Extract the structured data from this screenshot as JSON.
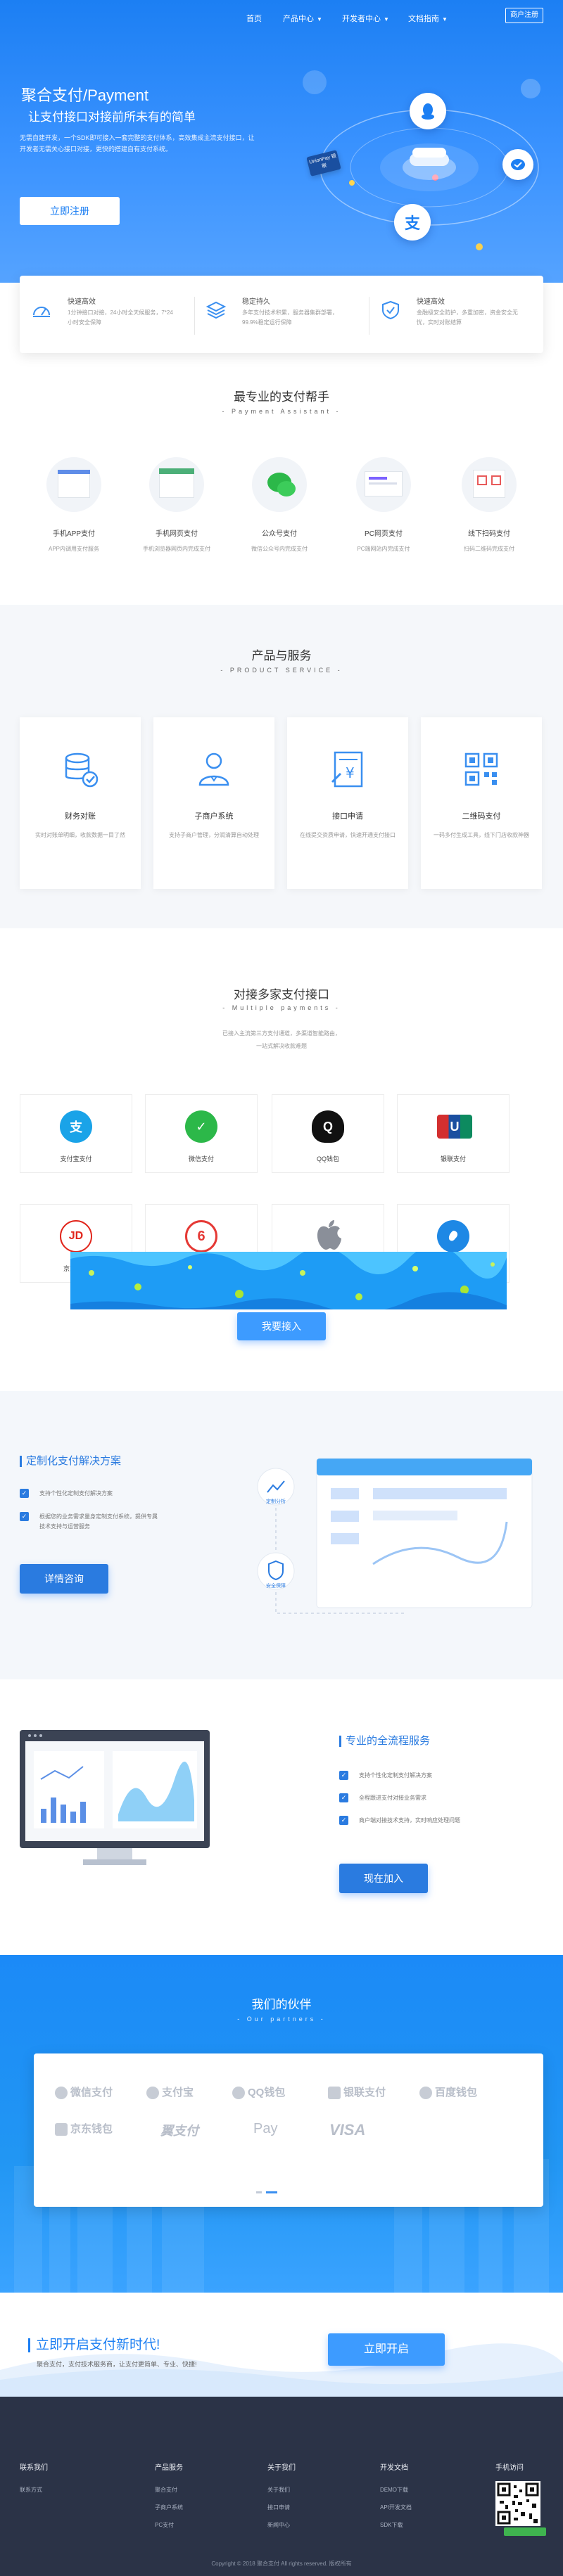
{
  "nav": {
    "items": [
      {
        "label": "首页",
        "caret": false
      },
      {
        "label": "产品中心",
        "caret": true
      },
      {
        "label": "开发者中心",
        "caret": true
      },
      {
        "label": "文档指南",
        "caret": true
      }
    ],
    "register_button": "商户注册"
  },
  "hero": {
    "title": "聚合支付/Payment",
    "subtitle": "让支付接口对接前所未有的简单",
    "description": "无需自建开发，一个SDK即可接入一套完整的支付体系，高效集成主流支付接口，让开发者无需关心接口对接，更快的搭建自有支付系统。",
    "cta": "立即注册",
    "badge": "UnionPay 银联"
  },
  "features": [
    {
      "title": "快速高效",
      "desc": "1分钟接口对接，24小时全天候服务，7*24小时安全保障",
      "icon": "speed-icon"
    },
    {
      "title": "稳定持久",
      "desc": "多年支付技术积累，服务器集群部署，99.9%稳定运行保障",
      "icon": "layers-icon"
    },
    {
      "title": "快速高效",
      "desc": "金融级安全防护，多重加密，资金安全无忧，实时对账结算",
      "icon": "shield-icon"
    }
  ],
  "assistant": {
    "title": "最专业的支付帮手",
    "subtitle": "- Payment Assistant -",
    "items": [
      {
        "label": "手机APP支付",
        "desc": "APP内调用支付服务"
      },
      {
        "label": "手机网页支付",
        "desc": "手机浏览器网页内完成支付"
      },
      {
        "label": "公众号支付",
        "desc": "微信公众号内完成支付"
      },
      {
        "label": "PC网页支付",
        "desc": "PC端网站内完成支付"
      },
      {
        "label": "线下扫码支付",
        "desc": "扫码二维码完成支付"
      }
    ]
  },
  "products": {
    "title": "产品与服务",
    "subtitle": "- PRODUCT SERVICE -",
    "items": [
      {
        "label": "财务对账",
        "desc": "实时对账单明细，收款数据一目了然"
      },
      {
        "label": "子商户系统",
        "desc": "支持子商户管理，分润清算自动处理"
      },
      {
        "label": "接口申请",
        "desc": "在线提交资质申请，快速开通支付接口"
      },
      {
        "label": "二维码支付",
        "desc": "一码多付生成工具，线下门店收款神器"
      }
    ]
  },
  "channels": {
    "title": "对接多家支付接口",
    "subtitle": "- Multiple payments -",
    "desc_lines": [
      "已接入主流第三方支付通道，多渠道智能路由，",
      "一站式解决收款难题"
    ],
    "items": [
      {
        "label": "支付宝支付",
        "color": "#1aa3e8",
        "glyph": "支",
        "icon": "alipay-icon"
      },
      {
        "label": "微信支付",
        "color": "#2cb849",
        "glyph": "✓",
        "icon": "wechat-icon"
      },
      {
        "label": "QQ钱包",
        "color": "#111111",
        "glyph": "Q",
        "icon": "qq-wallet-icon"
      },
      {
        "label": "银联支付",
        "color": "#d32f2f",
        "glyph": "U",
        "icon": "unionpay-icon"
      },
      {
        "label": "京东支付",
        "color": "#e1251b",
        "glyph": "JD",
        "icon": "jd-pay-icon"
      },
      {
        "label": "",
        "color": "#e53935",
        "glyph": "6",
        "icon": "yi-pay-icon"
      },
      {
        "label": "",
        "color": "#8a8f99",
        "glyph": "",
        "icon": "apple-pay-icon"
      },
      {
        "label": "",
        "color": "#1e88e5",
        "glyph": "",
        "icon": "baidu-wallet-icon"
      }
    ],
    "cta": "我要接入"
  },
  "custom": {
    "title": "定制化支付解决方案",
    "checks": [
      "支持个性化定制支付解决方案",
      "根据您的业务需求量身定制支付系统，提供专属技术支持与运营服务"
    ],
    "cta": "详情咨询",
    "chips": [
      "定制分析",
      "安全保障"
    ]
  },
  "service": {
    "title": "专业的全流程服务",
    "checks": [
      "支持个性化定制支付解决方案",
      "全程跟进支付对接业务需求",
      "商户端对接技术支持，实时响应处理问题"
    ],
    "cta": "现在加入"
  },
  "partners": {
    "title": "我们的伙伴",
    "subtitle": "- Our partners -",
    "logos": [
      "微信支付",
      "支付宝",
      "QQ钱包",
      "银联支付",
      "百度钱包",
      "京东钱包",
      "翼支付",
      "Pay",
      "VISA"
    ]
  },
  "cta_band": {
    "title": "立即开启支付新时代!",
    "sub": "聚合支付，支付技术服务商，让支付更简单、专业、快捷!",
    "button": "立即开启"
  },
  "footer": {
    "cols": [
      {
        "head": "联系我们",
        "links": [
          "联系方式"
        ]
      },
      {
        "head": "产品服务",
        "links": [
          "聚合支付",
          "子商户系统",
          "PC支付"
        ]
      },
      {
        "head": "关于我们",
        "links": [
          "关于我们",
          "接口申请",
          "新闻中心"
        ]
      },
      {
        "head": "开发文档",
        "links": [
          "DEMO下载",
          "API开发文档",
          "SDK下载"
        ]
      },
      {
        "head": "手机访问",
        "links": []
      }
    ],
    "copyright": "Copyright © 2018 聚合支付 All rights reserved. 版权所有"
  }
}
